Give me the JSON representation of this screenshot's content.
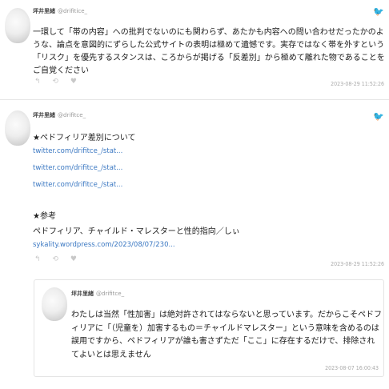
{
  "tweet1": {
    "author_name": "坪井里緒",
    "author_handle": "@drifitice_",
    "text": "一環して「帯の内容」への批判でないのにも関わらず、あたかも内容への問い合わせだったかのような、論点を意図的にずらした公式サイトの表明は極めて遺憾です。実存ではなく帯を外すという「リスク」を優先するスタンスは、ころからが掲げる「反差別」から極めて離れた物であることをご自覚ください",
    "timestamp": "2023-08-29 11:52:26",
    "actions": [
      "↰",
      "⟲",
      "♥"
    ]
  },
  "tweet2": {
    "author_name": "坪井里緒",
    "author_handle": "@drifitce_",
    "heading1": "★ペドフィリア差別について",
    "links1": [
      "twitter.com/drifitce_/stat...",
      "twitter.com/drifitce_/stat...",
      "twitter.com/drifitce_/stat..."
    ],
    "heading2": "★参考",
    "ref_text": "ペドフィリア、チャイルド・マレスターと性的指向／しぃ",
    "ref_link": "sykality.wordpress.com/2023/08/07/230...",
    "timestamp": "2023-08-29 11:52:26",
    "actions": [
      "↰",
      "⟲",
      "♥"
    ]
  },
  "quote": {
    "author_name": "坪井里緒",
    "author_handle": "@drifitce_",
    "text": "わたしは当然「性加害」は絶対許されてはならないと思っています。だからこそペドフィリアに「（児童を）加害するもの＝チャイルドマレスター」という意味を含めるのは誤用ですから、ペドフィリアが誰も害さずただ「ここ」に存在するだけで、排除されてよいとは思えません",
    "timestamp": "2023-08-07 16:00:43"
  },
  "icons": {
    "platform": "bird-icon"
  },
  "colors": {
    "link": "#3b78c2",
    "meta": "#aaaaaa",
    "platform": "#c9d7e3"
  }
}
